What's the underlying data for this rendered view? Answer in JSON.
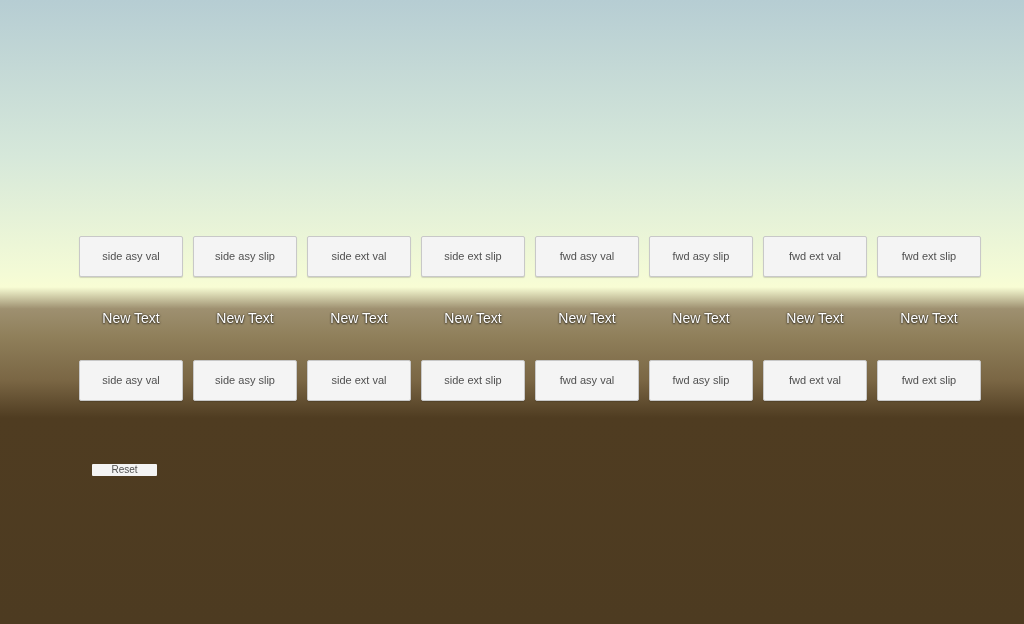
{
  "top_buttons": [
    "side asy val",
    "side asy slip",
    "side ext val",
    "side ext slip",
    "fwd asy val",
    "fwd asy slip",
    "fwd ext val",
    "fwd ext slip"
  ],
  "labels": [
    "New Text",
    "New Text",
    "New Text",
    "New Text",
    "New Text",
    "New Text",
    "New Text",
    "New Text"
  ],
  "bottom_buttons": [
    "side asy val",
    "side asy slip",
    "side ext val",
    "side ext slip",
    "fwd asy val",
    "fwd asy slip",
    "fwd ext val",
    "fwd ext slip"
  ],
  "reset_button": "Reset"
}
